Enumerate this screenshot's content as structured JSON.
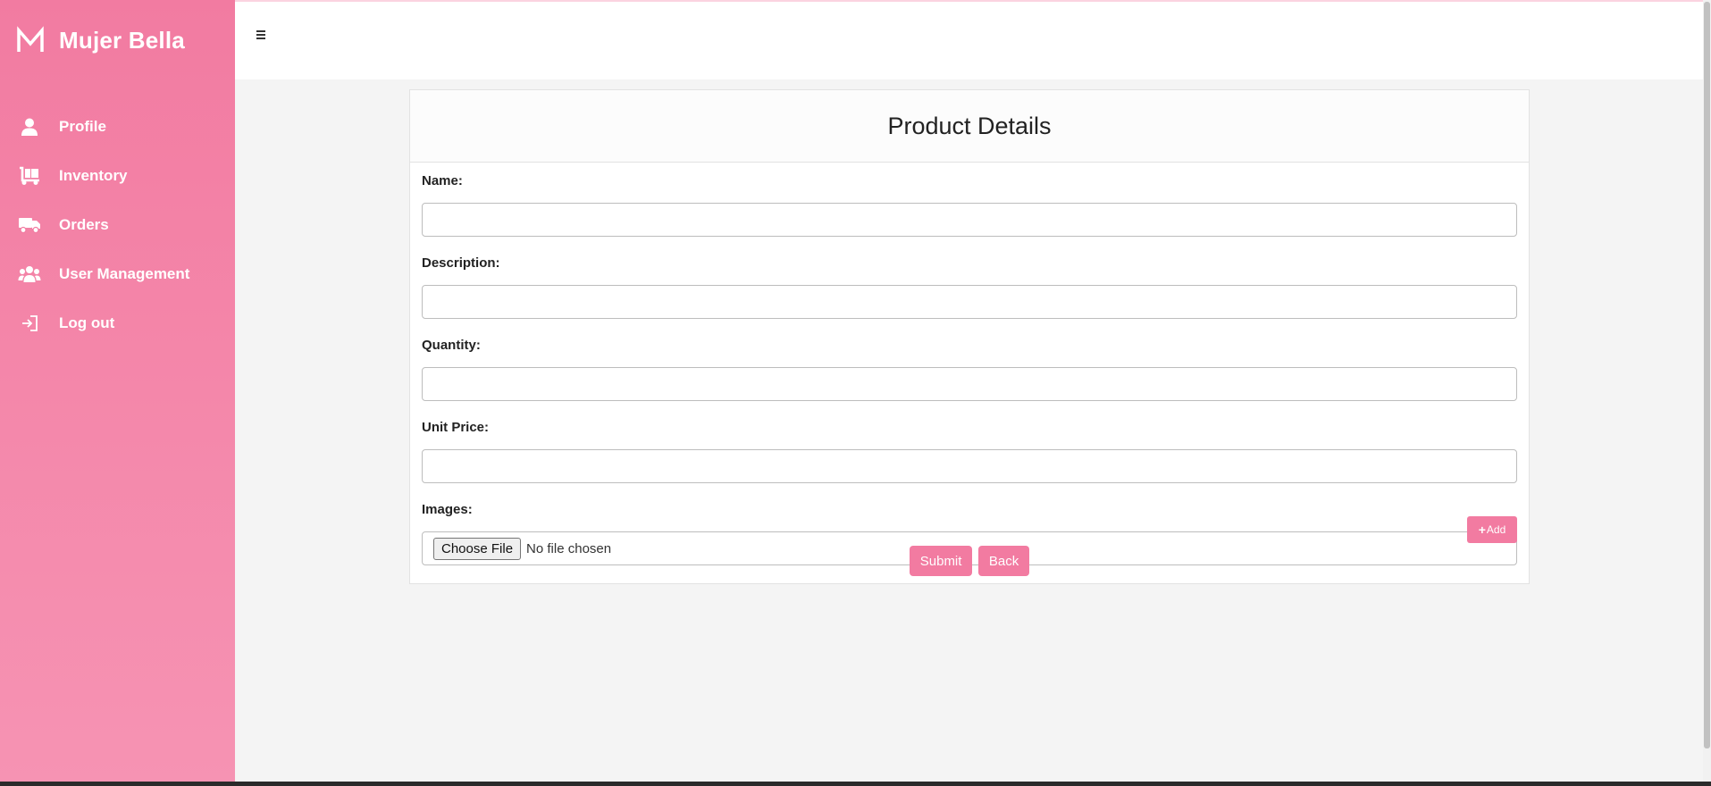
{
  "sidebar": {
    "brand": {
      "logo_icon": "brand-m-logo",
      "name": "Mujer Bella"
    },
    "items": [
      {
        "label": "Profile",
        "icon": "user-icon"
      },
      {
        "label": "Inventory",
        "icon": "dolly-icon"
      },
      {
        "label": "Orders",
        "icon": "truck-icon"
      },
      {
        "label": "User Management",
        "icon": "users-icon"
      },
      {
        "label": "Log out",
        "icon": "sign-out-icon"
      }
    ]
  },
  "topbar": {
    "menu_icon": "hamburger-icon"
  },
  "form": {
    "title": "Product Details",
    "fields": {
      "name": {
        "label": "Name:",
        "value": ""
      },
      "description": {
        "label": "Description:",
        "value": ""
      },
      "quantity": {
        "label": "Quantity:",
        "value": ""
      },
      "unit_price": {
        "label": "Unit Price:",
        "value": ""
      },
      "images": {
        "label": "Images:",
        "button": "Choose File",
        "status": "No file chosen"
      }
    },
    "add_button": "Add",
    "submit_button": "Submit",
    "back_button": "Back"
  },
  "colors": {
    "accent": "#f27ba1",
    "sidebar_bottom": "#f693b3",
    "background": "#f4f4f4"
  }
}
